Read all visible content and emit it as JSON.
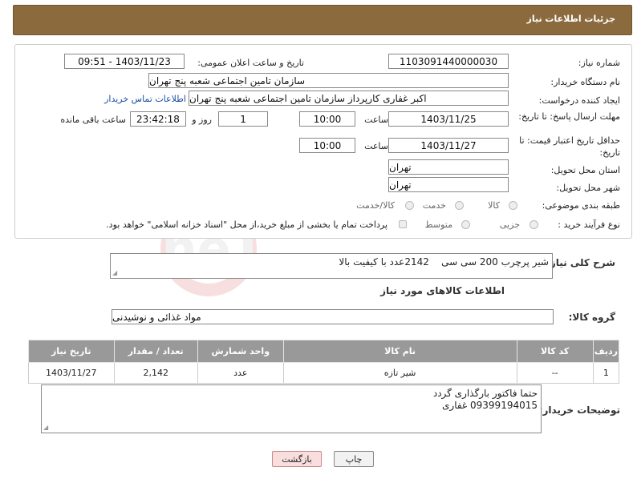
{
  "header": {
    "title": "جزئیات اطلاعات نیاز"
  },
  "form": {
    "need_number_label": "شماره نیاز:",
    "need_number": "1103091440000030",
    "announce_label": "تاریخ و ساعت اعلان عمومی:",
    "announce_value": "1403/11/23 - 09:51",
    "buyer_org_label": "نام دستگاه خریدار:",
    "buyer_org": "سازمان تامین اجتماعی شعبه پنج تهران",
    "creator_label": "ایجاد کننده درخواست:",
    "creator": "اکبر غفاری کارپرداز  سازمان تامین اجتماعی شعبه پنج تهران",
    "contact_link": "اطلاعات تماس خریدار",
    "reply_deadline_label": "مهلت ارسال پاسخ: تا تاریخ:",
    "reply_date": "1403/11/25",
    "hour_label": "ساعت",
    "reply_time": "10:00",
    "days_value": "1",
    "days_label": "روز و",
    "remaining_time": "23:42:18",
    "remaining_label": "ساعت باقی مانده",
    "validity_label": "حداقل تاریخ اعتبار قیمت: تا تاریخ:",
    "validity_date": "1403/11/27",
    "validity_time": "10:00",
    "province_label": "استان محل تحویل:",
    "province": "تهران",
    "city_label": "شهر محل تحویل:",
    "city": "تهران",
    "category_label": "طبقه بندی موضوعی:",
    "category_options": [
      "کالا",
      "خدمت",
      "کالا/خدمت"
    ],
    "process_label": "نوع فرآیند خرید :",
    "process_options": [
      "جزیی",
      "متوسط"
    ],
    "payment_note": "پرداخت تمام یا بخشی از مبلغ خرید،از محل \"اسناد خزانه اسلامی\" خواهد بود."
  },
  "description": {
    "label": "شرح کلی نیاز:",
    "value": "شیر پرچرب 200 سی سی    2142عدد با کیفیت بالا"
  },
  "goods": {
    "section_title": "اطلاعات کالاهای مورد نیاز",
    "group_label": "گروه کالا:",
    "group_value": "مواد غذائی و نوشیدنی",
    "columns": [
      "ردیف",
      "کد کالا",
      "نام کالا",
      "واحد شمارش",
      "تعداد / مقدار",
      "تاریخ نیاز"
    ],
    "rows": [
      {
        "row": "1",
        "code": "--",
        "name": "شیر تازه",
        "unit": "عدد",
        "qty": "2,142",
        "date": "1403/11/27"
      }
    ]
  },
  "buyer_notes": {
    "label": "توضیحات خریدار:",
    "line1": "حتما فاکتور بارگذاری گردد",
    "line2": "09399194015 غفاری"
  },
  "buttons": {
    "print": "چاپ",
    "back": "بازگشت"
  },
  "watermark": {
    "text": "AriaTender.neT"
  },
  "colors": {
    "header": "#8b6b3e",
    "table_header": "#999999",
    "back_button": "#f9dede"
  }
}
